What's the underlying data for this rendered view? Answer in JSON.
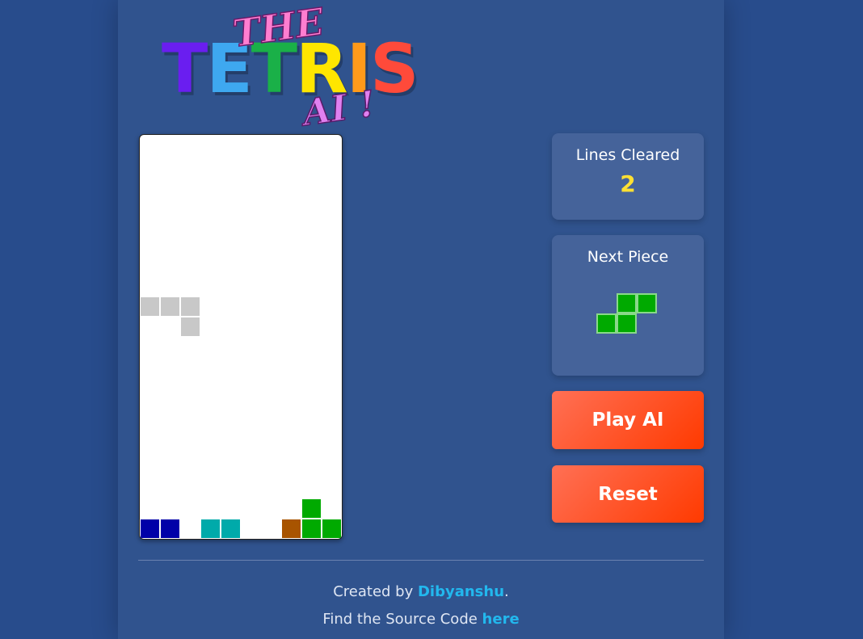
{
  "logo": {
    "the": "THE",
    "letters": [
      {
        "ch": "T",
        "color": "#6a1ef0"
      },
      {
        "ch": "E",
        "color": "#3ea8f0"
      },
      {
        "ch": "T",
        "color": "#1ab048"
      },
      {
        "ch": "R",
        "color": "#ffe600"
      },
      {
        "ch": "I",
        "color": "#ff9a1a"
      },
      {
        "ch": "S",
        "color": "#ff4a3a"
      }
    ],
    "ai": "AI !"
  },
  "board": {
    "cols": 10,
    "rows": 20,
    "cells": [
      {
        "col": 0,
        "row": 8,
        "color": "#c8c8c8"
      },
      {
        "col": 1,
        "row": 8,
        "color": "#c8c8c8"
      },
      {
        "col": 2,
        "row": 8,
        "color": "#c8c8c8"
      },
      {
        "col": 2,
        "row": 9,
        "color": "#c8c8c8"
      },
      {
        "col": 8,
        "row": 18,
        "color": "#00aa00"
      },
      {
        "col": 0,
        "row": 19,
        "color": "#0000a8"
      },
      {
        "col": 1,
        "row": 19,
        "color": "#0000a8"
      },
      {
        "col": 3,
        "row": 19,
        "color": "#00aaaa"
      },
      {
        "col": 4,
        "row": 19,
        "color": "#00aaaa"
      },
      {
        "col": 7,
        "row": 19,
        "color": "#a85400"
      },
      {
        "col": 8,
        "row": 19,
        "color": "#00aa00"
      },
      {
        "col": 9,
        "row": 19,
        "color": "#00aa00"
      }
    ]
  },
  "stats": {
    "lines_title": "Lines Cleared",
    "lines_value": "2",
    "next_title": "Next Piece",
    "next_piece": {
      "color": "#00aa00",
      "cells": [
        [
          1,
          0
        ],
        [
          2,
          0
        ],
        [
          0,
          1
        ],
        [
          1,
          1
        ]
      ]
    }
  },
  "buttons": {
    "play": "Play AI",
    "reset": "Reset"
  },
  "footer": {
    "created_prefix": "Created by ",
    "author": "Dibyanshu",
    "created_suffix": ".",
    "source_prefix": "Find the Source Code ",
    "source_link": "here"
  }
}
